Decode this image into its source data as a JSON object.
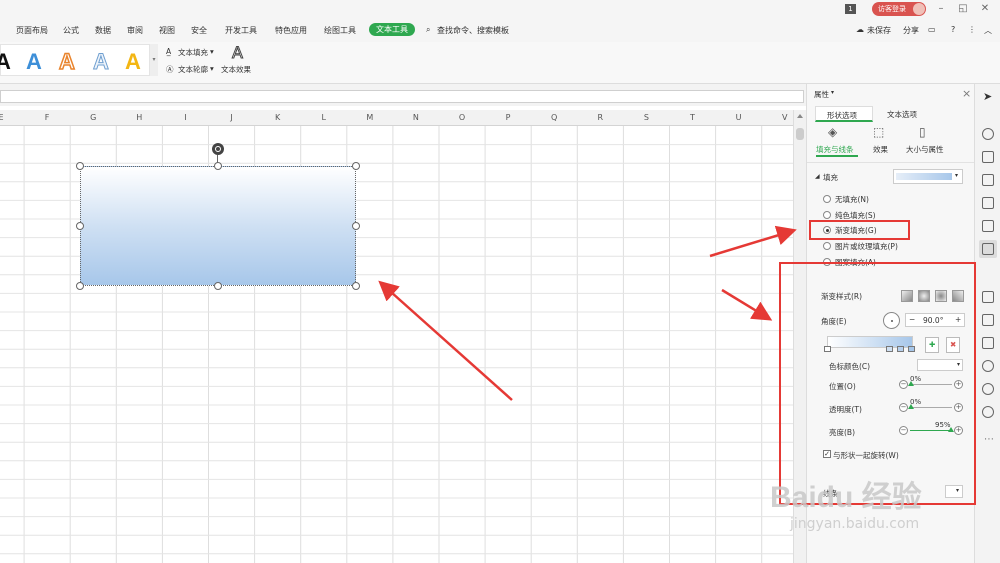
{
  "titlebar": {
    "badge": "1",
    "login_label": "访客登录",
    "min": "–",
    "restore": "◱",
    "close": "✕"
  },
  "menu": {
    "items": [
      "页面布局",
      "公式",
      "数据",
      "审阅",
      "视图",
      "安全",
      "开发工具",
      "特色应用",
      "绘图工具"
    ],
    "active": "文本工具",
    "search": "查找命令、搜索模板",
    "unsaved": "未保存",
    "share": "分享",
    "help": "?",
    "more": "⋮",
    "collapse": "︿"
  },
  "ribbon": {
    "style_samples": [
      "A",
      "A",
      "A",
      "A",
      "A"
    ],
    "text_fill": "文本填充",
    "text_outline": "文本轮廓",
    "text_effect": "文本效果",
    "effect_glyph": "A"
  },
  "grid": {
    "columns": [
      "E",
      "F",
      "G",
      "H",
      "I",
      "J",
      "K",
      "L",
      "M",
      "N",
      "O",
      "P",
      "Q",
      "R",
      "S",
      "T",
      "U",
      "V"
    ]
  },
  "pane": {
    "title": "属性",
    "close": "×",
    "tabs": [
      "形状选项",
      "文本选项"
    ],
    "subtabs": [
      "填充与线条",
      "效果",
      "大小与属性"
    ],
    "fill_section": "填充",
    "fill_options": [
      {
        "label": "无填充(N)",
        "checked": false
      },
      {
        "label": "纯色填充(S)",
        "checked": false
      },
      {
        "label": "渐变填充(G)",
        "checked": true
      },
      {
        "label": "图片或纹理填充(P)",
        "checked": false
      },
      {
        "label": "图案填充(A)",
        "checked": false
      }
    ],
    "gradient_style_label": "渐变样式(R)",
    "angle_label": "角度(E)",
    "angle_value": "90.0°",
    "minus": "−",
    "plus": "+",
    "stop_color_label": "色标颜色(C)",
    "position_label": "位置(O)",
    "position_value": "0%",
    "transparency_label": "透明度(T)",
    "transparency_value": "0%",
    "brightness_label": "亮度(B)",
    "brightness_value": "95%",
    "rotate_with_shape": "与形状一起旋转(W)",
    "line_section": "线条",
    "brightness_level": 0.95,
    "colors": {
      "accent": "#2fa850",
      "gradient_top": "#ffffff",
      "gradient_bottom": "#a7c7ea",
      "annotation": "#e53935"
    }
  },
  "watermark": {
    "text": "Baidu 经验",
    "url": "jingyan.baidu.com"
  }
}
